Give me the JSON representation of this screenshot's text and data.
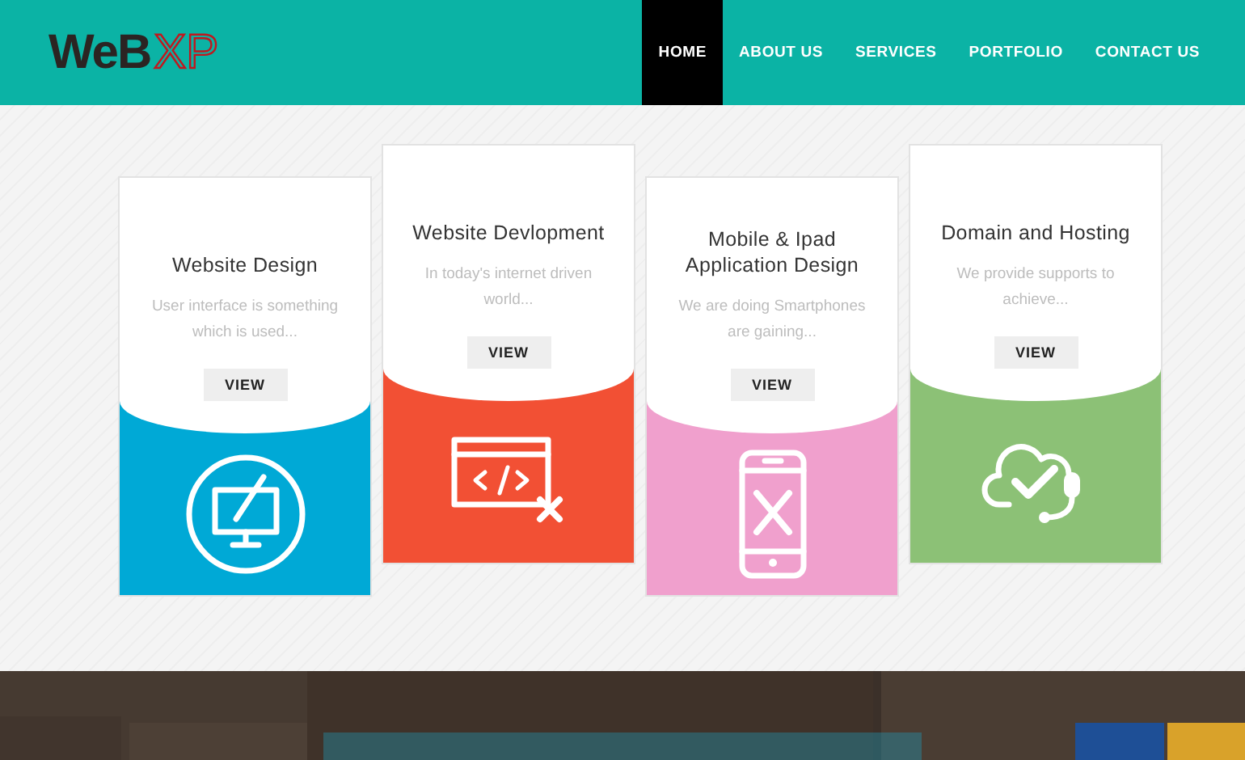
{
  "logo": {
    "mark": "WeB",
    "suffix": "XP"
  },
  "nav": [
    {
      "label": "HOME",
      "selected": true
    },
    {
      "label": "ABOUT US",
      "selected": false
    },
    {
      "label": "SERVICES",
      "selected": false
    },
    {
      "label": "PORTFOLIO",
      "selected": false
    },
    {
      "label": "CONTACT US",
      "selected": false
    }
  ],
  "services": [
    {
      "title": "Website Design",
      "description": "User interface is something which is used...",
      "button": "VIEW",
      "color": "#00a9d6"
    },
    {
      "title": "Website Devlopment",
      "description": "In today's internet driven world...",
      "button": "VIEW",
      "color": "#f25034"
    },
    {
      "title": "Mobile & Ipad Application Design",
      "description": "We are doing Smartphones are gaining...",
      "button": "VIEW",
      "color": "#f0a0cd"
    },
    {
      "title": "Domain and Hosting",
      "description": "We provide supports to achieve...",
      "button": "VIEW",
      "color": "#8cc176"
    }
  ]
}
